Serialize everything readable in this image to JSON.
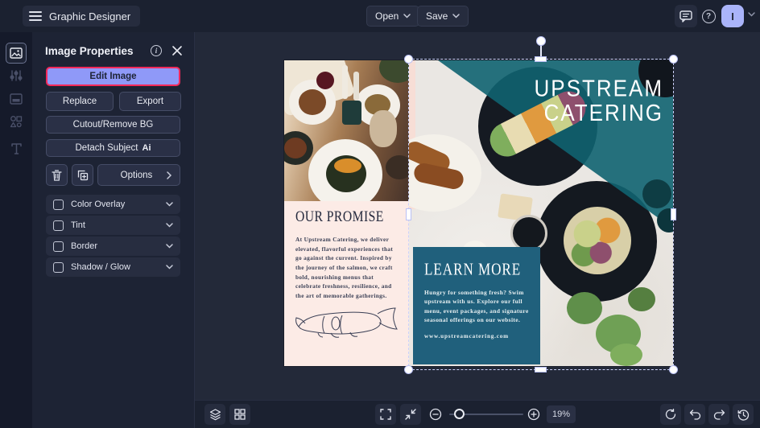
{
  "topbar": {
    "title": "Graphic Designer",
    "open_label": "Open",
    "save_label": "Save",
    "avatar_initial": "I"
  },
  "icons": {
    "help_glyph": "?"
  },
  "panel": {
    "title": "Image Properties",
    "edit_image_label": "Edit Image",
    "replace_label": "Replace",
    "export_label": "Export",
    "cutout_label": "Cutout/Remove BG",
    "detach_label": "Detach Subject",
    "detach_badge": "Ai",
    "options_label": "Options",
    "toggles": [
      {
        "label": "Color Overlay",
        "checked": false
      },
      {
        "label": "Tint",
        "checked": false
      },
      {
        "label": "Border",
        "checked": false
      },
      {
        "label": "Shadow / Glow",
        "checked": false
      }
    ]
  },
  "canvas": {
    "flyer": {
      "brand_line1": "UPSTREAM",
      "brand_line2": "CATERING",
      "promise_title": "OUR PROMISE",
      "promise_body": "At Upstream Catering, we deliver elevated, flavorful experiences that go against the current. Inspired by the journey of the salmon, we craft bold, nourishing menus that celebrate freshness, resilience, and the art of memorable gatherings.",
      "learn_title": "LEARN MORE",
      "learn_body": "Hungry for something fresh? Swim upstream with us. Explore our full menu, event packages, and signature seasonal offerings on our website.",
      "website": "www.upstreamcatering.com"
    }
  },
  "bottombar": {
    "zoom_level": "19%"
  },
  "colors": {
    "accent_purple": "#8f99f8",
    "highlight_red": "#f5295b",
    "avatar_purple": "#aab4fa",
    "flyer_teal_overlay": "#106370",
    "flyer_learn_box": "#20607c",
    "flyer_pink": "#fcebe6",
    "ui_dark": "#1b2130"
  }
}
